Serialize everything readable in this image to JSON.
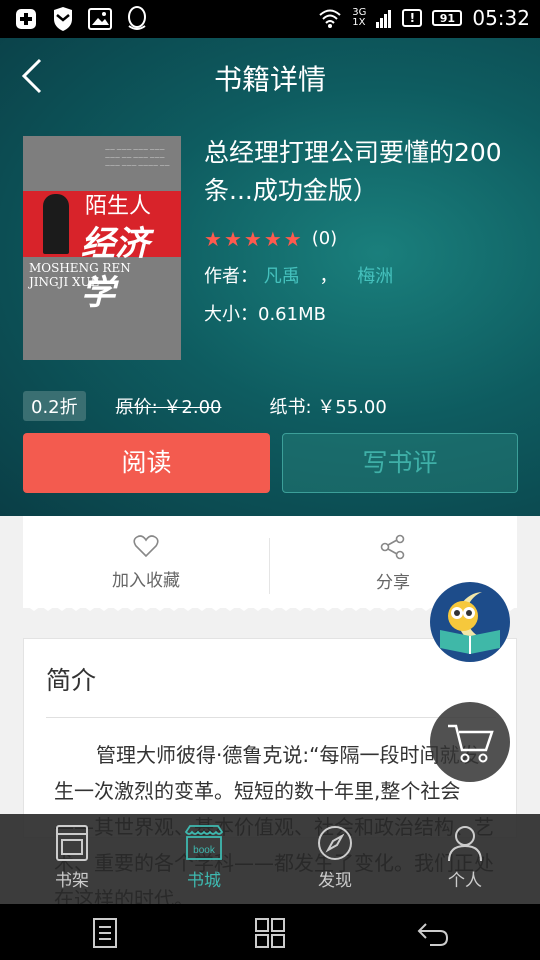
{
  "status_bar": {
    "time": "05:32",
    "battery": "91",
    "net_top": "3G",
    "net_bottom": "1X"
  },
  "header": {
    "title": "书籍详情"
  },
  "book": {
    "title": "总经理打理公司要懂的200条...成功金版）",
    "rating_count": "(0)",
    "stars": 5,
    "author_label": "作者：",
    "author1": "凡禹",
    "author_sep": "，",
    "author2": "梅洲",
    "size_label": "大小：",
    "size": "0.61MB",
    "cover_title1": "陌生人",
    "cover_title2": "经济学",
    "cover_pinyin1": "MOSHENG REN",
    "cover_pinyin2": "JINGJI XUE"
  },
  "price": {
    "discount": "0.2折",
    "original": "原价: ￥2.00",
    "paper": "纸书: ￥55.00"
  },
  "buttons": {
    "read": "阅读",
    "review": "写书评"
  },
  "actions": {
    "favorite": "加入收藏",
    "share": "分享"
  },
  "intro": {
    "title": "简介",
    "text": "管理大师彼得·德鲁克说:“每隔一段时间就发生一次激烈的变革。短短的数十年里,整个社会——其世界观、基本价值观、社会和政治结构、艺术、重要的各个学科——都发生了变化。我们正处在这样的时代。"
  },
  "tabs": [
    {
      "label": "书架",
      "icon": "bookshelf-icon"
    },
    {
      "label": "书城",
      "icon": "bookstore-icon"
    },
    {
      "label": "发现",
      "icon": "compass-icon"
    },
    {
      "label": "个人",
      "icon": "person-icon"
    }
  ],
  "colors": {
    "accent": "#f35b4f",
    "teal": "#3eb9b0",
    "hero_bg": "#0e5c60"
  }
}
